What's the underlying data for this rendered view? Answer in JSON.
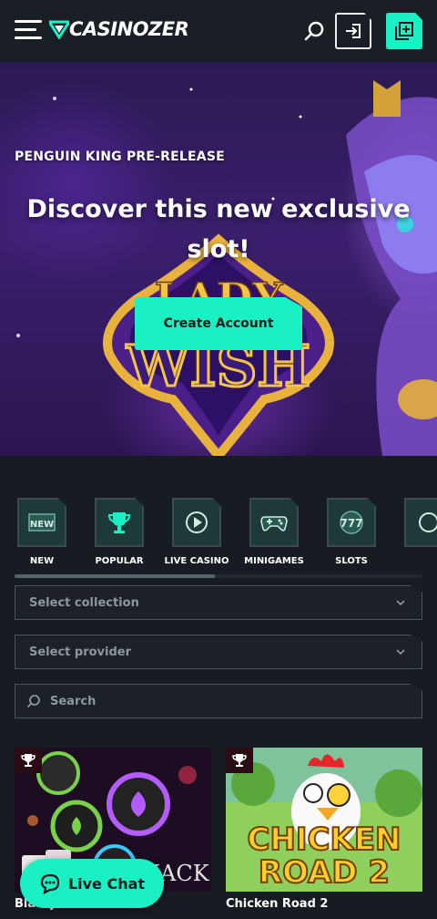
{
  "brand": {
    "logo_text": "CASINOZER",
    "accent": "#19f0c4",
    "bg": "#161c22"
  },
  "header": {
    "menu_icon": "hamburger-icon",
    "search_icon": "search-icon",
    "login_icon": "login-icon",
    "register_icon": "add-user-icon"
  },
  "hero": {
    "kicker": "PENGUIN KING PRE-RELEASE",
    "title": "Discover this new exclusive slot!",
    "cta_label": "Create Account",
    "game_art_text": "LADY WISH"
  },
  "categories": [
    {
      "label": "NEW",
      "icon": "new-badge-icon"
    },
    {
      "label": "POPULAR",
      "icon": "trophy-icon"
    },
    {
      "label": "LIVE CASINO",
      "icon": "play-icon"
    },
    {
      "label": "MINIGAMES",
      "icon": "gamepad-icon"
    },
    {
      "label": "SLOTS",
      "icon": "slot-777-icon"
    },
    {
      "label": "",
      "icon": "more-icon"
    }
  ],
  "filters": {
    "collection_placeholder": "Select collection",
    "provider_placeholder": "Select provider",
    "search_placeholder": "Search"
  },
  "games": [
    {
      "name": "Blackjack",
      "art_text": "JACK"
    },
    {
      "name": "Chicken Road 2",
      "art_text_1": "CHICKEN",
      "art_text_2": "ROAD 2"
    }
  ],
  "live_chat": {
    "label": "Live Chat"
  }
}
